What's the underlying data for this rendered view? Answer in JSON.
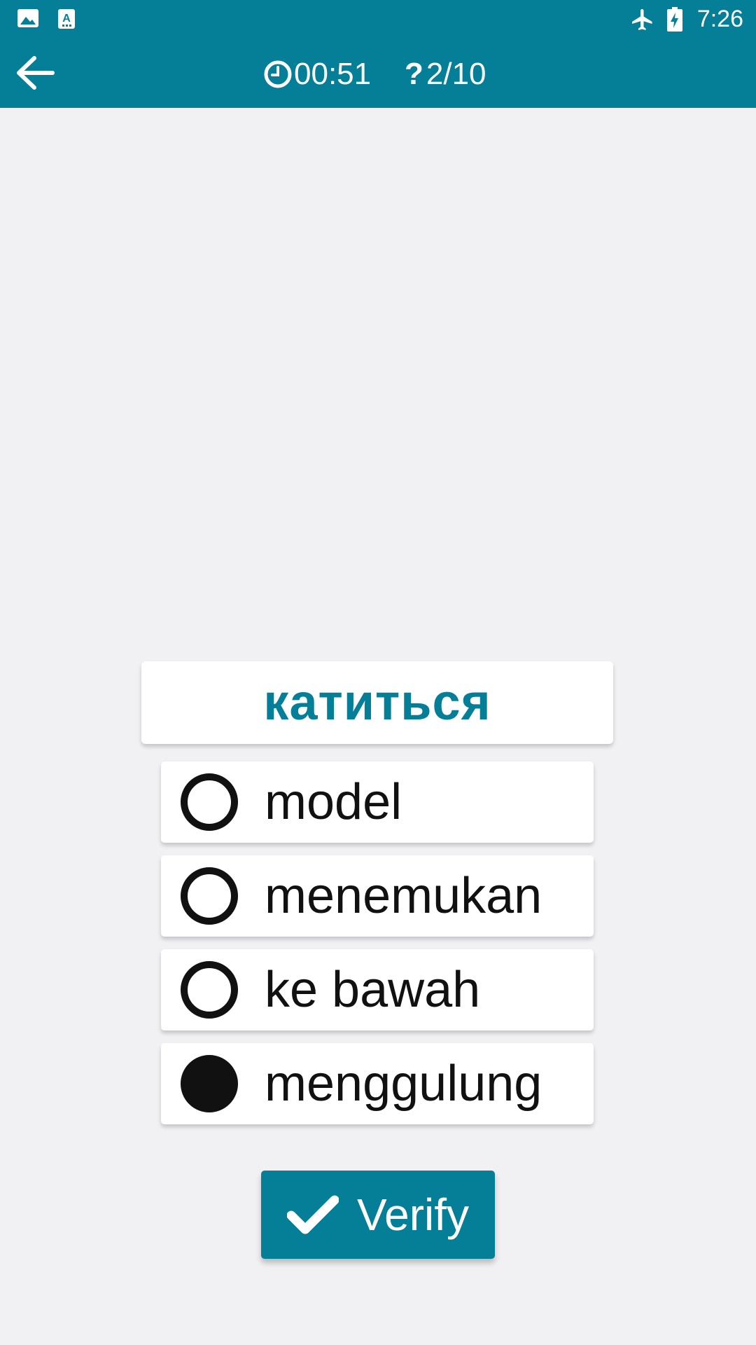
{
  "status_bar": {
    "time": "7:26",
    "left_icons": [
      "image-icon",
      "text-a-icon"
    ],
    "right_icons": [
      "airplane-mode-icon",
      "battery-charging-icon"
    ]
  },
  "app_bar": {
    "back_icon": "arrow-left-icon",
    "timer_icon": "clock-icon",
    "timer": "00:51",
    "question_icon": "question-mark-icon",
    "progress": "2/10"
  },
  "quiz": {
    "word": "катиться",
    "options": [
      {
        "label": "model",
        "selected": false
      },
      {
        "label": "menemukan",
        "selected": false
      },
      {
        "label": "ke bawah",
        "selected": false
      },
      {
        "label": "menggulung",
        "selected": true
      }
    ]
  },
  "verify_button": {
    "icon": "check-icon",
    "label": "Verify"
  },
  "colors": {
    "accent": "#047f97",
    "background": "#f1f0f3",
    "card": "#ffffff"
  }
}
